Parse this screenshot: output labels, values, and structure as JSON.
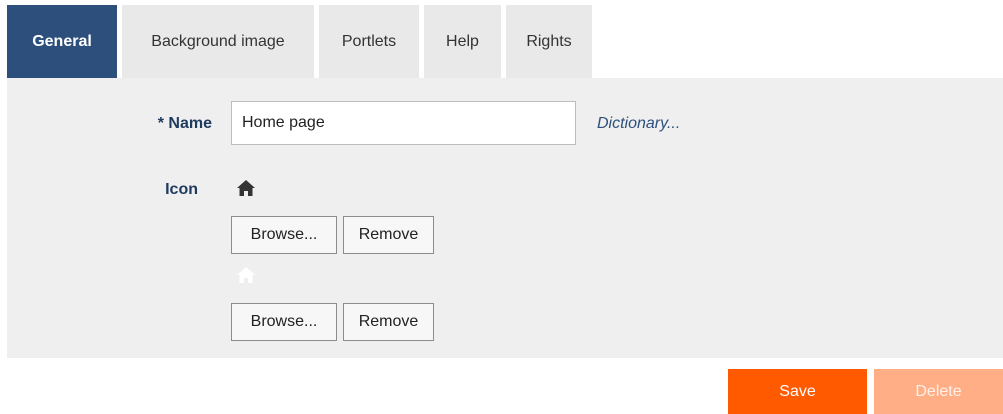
{
  "tabs": [
    {
      "label": "General",
      "active": true
    },
    {
      "label": "Background image",
      "active": false
    },
    {
      "label": "Portlets",
      "active": false
    },
    {
      "label": "Help",
      "active": false
    },
    {
      "label": "Rights",
      "active": false
    }
  ],
  "form": {
    "name_label": "* Name",
    "name_value": "Home page",
    "dictionary_link": "Dictionary...",
    "icon_label": "Icon",
    "icon_primary": "home-icon",
    "icon_secondary": "home-icon-white",
    "browse_label": "Browse...",
    "remove_label": "Remove"
  },
  "actions": {
    "save_label": "Save",
    "delete_label": "Delete"
  },
  "colors": {
    "tab_active": "#2c4f7c",
    "tab_inactive": "#e9e9e9",
    "panel": "#efefef",
    "save": "#ff5a00",
    "delete": "#ffae85"
  }
}
